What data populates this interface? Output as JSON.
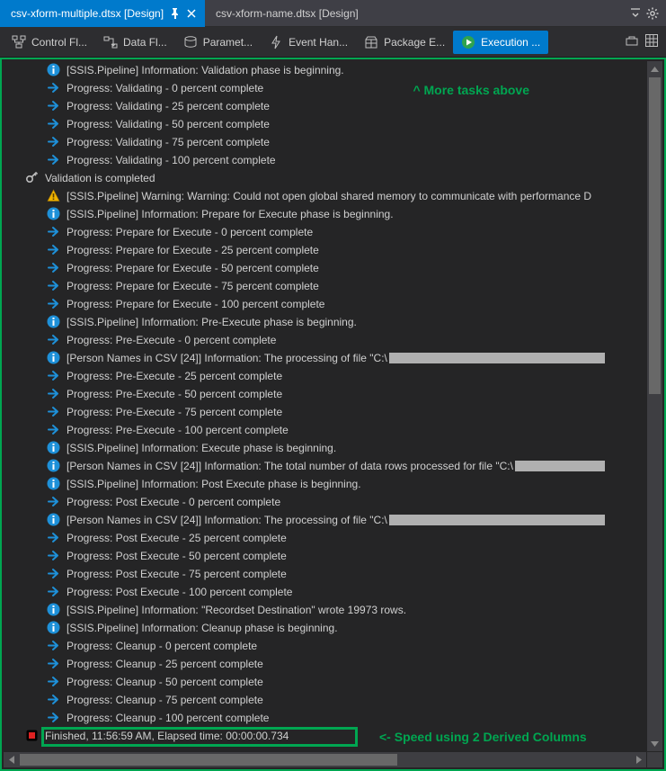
{
  "tabs": {
    "active": "csv-xform-multiple.dtsx [Design]",
    "other": "csv-xform-name.dtsx [Design]"
  },
  "designTabs": {
    "control": "Control Fl...",
    "data": "Data Fl...",
    "param": "Paramet...",
    "event": "Event Han...",
    "package": "Package E...",
    "exec": "Execution ..."
  },
  "annotations": {
    "top": "^ More tasks above",
    "bottom": "<- Speed using 2 Derived Columns"
  },
  "log": [
    {
      "icon": "info",
      "text": "[SSIS.Pipeline] Information: Validation phase is beginning."
    },
    {
      "icon": "arrow",
      "text": "Progress: Validating - 0 percent complete"
    },
    {
      "icon": "arrow",
      "text": "Progress: Validating - 25 percent complete"
    },
    {
      "icon": "arrow",
      "text": "Progress: Validating - 50 percent complete"
    },
    {
      "icon": "arrow",
      "text": "Progress: Validating - 75 percent complete"
    },
    {
      "icon": "arrow",
      "text": "Progress: Validating - 100 percent complete"
    },
    {
      "icon": "key",
      "text": "Validation is completed",
      "level": 1
    },
    {
      "icon": "warn",
      "text": "[SSIS.Pipeline] Warning: Warning: Could not open global shared memory to communicate with performance D"
    },
    {
      "icon": "info",
      "text": "[SSIS.Pipeline] Information: Prepare for Execute phase is beginning."
    },
    {
      "icon": "arrow",
      "text": "Progress: Prepare for Execute - 0 percent complete"
    },
    {
      "icon": "arrow",
      "text": "Progress: Prepare for Execute - 25 percent complete"
    },
    {
      "icon": "arrow",
      "text": "Progress: Prepare for Execute - 50 percent complete"
    },
    {
      "icon": "arrow",
      "text": "Progress: Prepare for Execute - 75 percent complete"
    },
    {
      "icon": "arrow",
      "text": "Progress: Prepare for Execute - 100 percent complete"
    },
    {
      "icon": "info",
      "text": "[SSIS.Pipeline] Information: Pre-Execute phase is beginning."
    },
    {
      "icon": "arrow",
      "text": "Progress: Pre-Execute - 0 percent complete"
    },
    {
      "icon": "info",
      "text": "[Person Names in CSV [24]] Information: The processing of file \"C:\\",
      "redact": 240
    },
    {
      "icon": "arrow",
      "text": "Progress: Pre-Execute - 25 percent complete"
    },
    {
      "icon": "arrow",
      "text": "Progress: Pre-Execute - 50 percent complete"
    },
    {
      "icon": "arrow",
      "text": "Progress: Pre-Execute - 75 percent complete"
    },
    {
      "icon": "arrow",
      "text": "Progress: Pre-Execute - 100 percent complete"
    },
    {
      "icon": "info",
      "text": "[SSIS.Pipeline] Information: Execute phase is beginning."
    },
    {
      "icon": "info",
      "text": "[Person Names in CSV [24]] Information: The total number of data rows processed for file \"C:\\",
      "redact": 100
    },
    {
      "icon": "info",
      "text": "[SSIS.Pipeline] Information: Post Execute phase is beginning."
    },
    {
      "icon": "arrow",
      "text": "Progress: Post Execute - 0 percent complete"
    },
    {
      "icon": "info",
      "text": "[Person Names in CSV [24]] Information: The processing of file \"C:\\",
      "redact": 240
    },
    {
      "icon": "arrow",
      "text": "Progress: Post Execute - 25 percent complete"
    },
    {
      "icon": "arrow",
      "text": "Progress: Post Execute - 50 percent complete"
    },
    {
      "icon": "arrow",
      "text": "Progress: Post Execute - 75 percent complete"
    },
    {
      "icon": "arrow",
      "text": "Progress: Post Execute - 100 percent complete"
    },
    {
      "icon": "info",
      "text": "[SSIS.Pipeline] Information: \"Recordset Destination\" wrote 19973 rows."
    },
    {
      "icon": "info",
      "text": "[SSIS.Pipeline] Information: Cleanup phase is beginning."
    },
    {
      "icon": "arrow",
      "text": "Progress: Cleanup - 0 percent complete"
    },
    {
      "icon": "arrow",
      "text": "Progress: Cleanup - 25 percent complete"
    },
    {
      "icon": "arrow",
      "text": "Progress: Cleanup - 50 percent complete"
    },
    {
      "icon": "arrow",
      "text": "Progress: Cleanup - 75 percent complete"
    },
    {
      "icon": "arrow",
      "text": "Progress: Cleanup - 100 percent complete"
    },
    {
      "icon": "stop",
      "text": "Finished, 11:56:59 AM, Elapsed time: 00:00:00.734",
      "level": 1
    }
  ]
}
